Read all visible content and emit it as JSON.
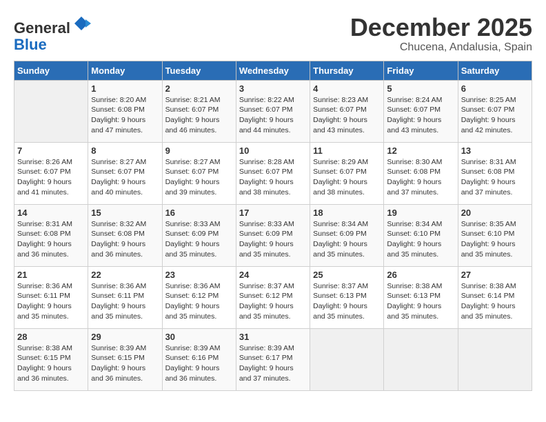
{
  "header": {
    "logo_line1": "General",
    "logo_line2": "Blue",
    "month": "December 2025",
    "location": "Chucena, Andalusia, Spain"
  },
  "weekdays": [
    "Sunday",
    "Monday",
    "Tuesday",
    "Wednesday",
    "Thursday",
    "Friday",
    "Saturday"
  ],
  "weeks": [
    [
      {
        "day": "",
        "empty": true
      },
      {
        "day": "1",
        "sunrise": "Sunrise: 8:20 AM",
        "sunset": "Sunset: 6:08 PM",
        "daylight": "Daylight: 9 hours and 47 minutes."
      },
      {
        "day": "2",
        "sunrise": "Sunrise: 8:21 AM",
        "sunset": "Sunset: 6:07 PM",
        "daylight": "Daylight: 9 hours and 46 minutes."
      },
      {
        "day": "3",
        "sunrise": "Sunrise: 8:22 AM",
        "sunset": "Sunset: 6:07 PM",
        "daylight": "Daylight: 9 hours and 44 minutes."
      },
      {
        "day": "4",
        "sunrise": "Sunrise: 8:23 AM",
        "sunset": "Sunset: 6:07 PM",
        "daylight": "Daylight: 9 hours and 43 minutes."
      },
      {
        "day": "5",
        "sunrise": "Sunrise: 8:24 AM",
        "sunset": "Sunset: 6:07 PM",
        "daylight": "Daylight: 9 hours and 43 minutes."
      },
      {
        "day": "6",
        "sunrise": "Sunrise: 8:25 AM",
        "sunset": "Sunset: 6:07 PM",
        "daylight": "Daylight: 9 hours and 42 minutes."
      }
    ],
    [
      {
        "day": "7",
        "sunrise": "Sunrise: 8:26 AM",
        "sunset": "Sunset: 6:07 PM",
        "daylight": "Daylight: 9 hours and 41 minutes."
      },
      {
        "day": "8",
        "sunrise": "Sunrise: 8:27 AM",
        "sunset": "Sunset: 6:07 PM",
        "daylight": "Daylight: 9 hours and 40 minutes."
      },
      {
        "day": "9",
        "sunrise": "Sunrise: 8:27 AM",
        "sunset": "Sunset: 6:07 PM",
        "daylight": "Daylight: 9 hours and 39 minutes."
      },
      {
        "day": "10",
        "sunrise": "Sunrise: 8:28 AM",
        "sunset": "Sunset: 6:07 PM",
        "daylight": "Daylight: 9 hours and 38 minutes."
      },
      {
        "day": "11",
        "sunrise": "Sunrise: 8:29 AM",
        "sunset": "Sunset: 6:07 PM",
        "daylight": "Daylight: 9 hours and 38 minutes."
      },
      {
        "day": "12",
        "sunrise": "Sunrise: 8:30 AM",
        "sunset": "Sunset: 6:08 PM",
        "daylight": "Daylight: 9 hours and 37 minutes."
      },
      {
        "day": "13",
        "sunrise": "Sunrise: 8:31 AM",
        "sunset": "Sunset: 6:08 PM",
        "daylight": "Daylight: 9 hours and 37 minutes."
      }
    ],
    [
      {
        "day": "14",
        "sunrise": "Sunrise: 8:31 AM",
        "sunset": "Sunset: 6:08 PM",
        "daylight": "Daylight: 9 hours and 36 minutes."
      },
      {
        "day": "15",
        "sunrise": "Sunrise: 8:32 AM",
        "sunset": "Sunset: 6:08 PM",
        "daylight": "Daylight: 9 hours and 36 minutes."
      },
      {
        "day": "16",
        "sunrise": "Sunrise: 8:33 AM",
        "sunset": "Sunset: 6:09 PM",
        "daylight": "Daylight: 9 hours and 35 minutes."
      },
      {
        "day": "17",
        "sunrise": "Sunrise: 8:33 AM",
        "sunset": "Sunset: 6:09 PM",
        "daylight": "Daylight: 9 hours and 35 minutes."
      },
      {
        "day": "18",
        "sunrise": "Sunrise: 8:34 AM",
        "sunset": "Sunset: 6:09 PM",
        "daylight": "Daylight: 9 hours and 35 minutes."
      },
      {
        "day": "19",
        "sunrise": "Sunrise: 8:34 AM",
        "sunset": "Sunset: 6:10 PM",
        "daylight": "Daylight: 9 hours and 35 minutes."
      },
      {
        "day": "20",
        "sunrise": "Sunrise: 8:35 AM",
        "sunset": "Sunset: 6:10 PM",
        "daylight": "Daylight: 9 hours and 35 minutes."
      }
    ],
    [
      {
        "day": "21",
        "sunrise": "Sunrise: 8:36 AM",
        "sunset": "Sunset: 6:11 PM",
        "daylight": "Daylight: 9 hours and 35 minutes."
      },
      {
        "day": "22",
        "sunrise": "Sunrise: 8:36 AM",
        "sunset": "Sunset: 6:11 PM",
        "daylight": "Daylight: 9 hours and 35 minutes."
      },
      {
        "day": "23",
        "sunrise": "Sunrise: 8:36 AM",
        "sunset": "Sunset: 6:12 PM",
        "daylight": "Daylight: 9 hours and 35 minutes."
      },
      {
        "day": "24",
        "sunrise": "Sunrise: 8:37 AM",
        "sunset": "Sunset: 6:12 PM",
        "daylight": "Daylight: 9 hours and 35 minutes."
      },
      {
        "day": "25",
        "sunrise": "Sunrise: 8:37 AM",
        "sunset": "Sunset: 6:13 PM",
        "daylight": "Daylight: 9 hours and 35 minutes."
      },
      {
        "day": "26",
        "sunrise": "Sunrise: 8:38 AM",
        "sunset": "Sunset: 6:13 PM",
        "daylight": "Daylight: 9 hours and 35 minutes."
      },
      {
        "day": "27",
        "sunrise": "Sunrise: 8:38 AM",
        "sunset": "Sunset: 6:14 PM",
        "daylight": "Daylight: 9 hours and 35 minutes."
      }
    ],
    [
      {
        "day": "28",
        "sunrise": "Sunrise: 8:38 AM",
        "sunset": "Sunset: 6:15 PM",
        "daylight": "Daylight: 9 hours and 36 minutes."
      },
      {
        "day": "29",
        "sunrise": "Sunrise: 8:39 AM",
        "sunset": "Sunset: 6:15 PM",
        "daylight": "Daylight: 9 hours and 36 minutes."
      },
      {
        "day": "30",
        "sunrise": "Sunrise: 8:39 AM",
        "sunset": "Sunset: 6:16 PM",
        "daylight": "Daylight: 9 hours and 36 minutes."
      },
      {
        "day": "31",
        "sunrise": "Sunrise: 8:39 AM",
        "sunset": "Sunset: 6:17 PM",
        "daylight": "Daylight: 9 hours and 37 minutes."
      },
      {
        "day": "",
        "empty": true
      },
      {
        "day": "",
        "empty": true
      },
      {
        "day": "",
        "empty": true
      }
    ]
  ]
}
